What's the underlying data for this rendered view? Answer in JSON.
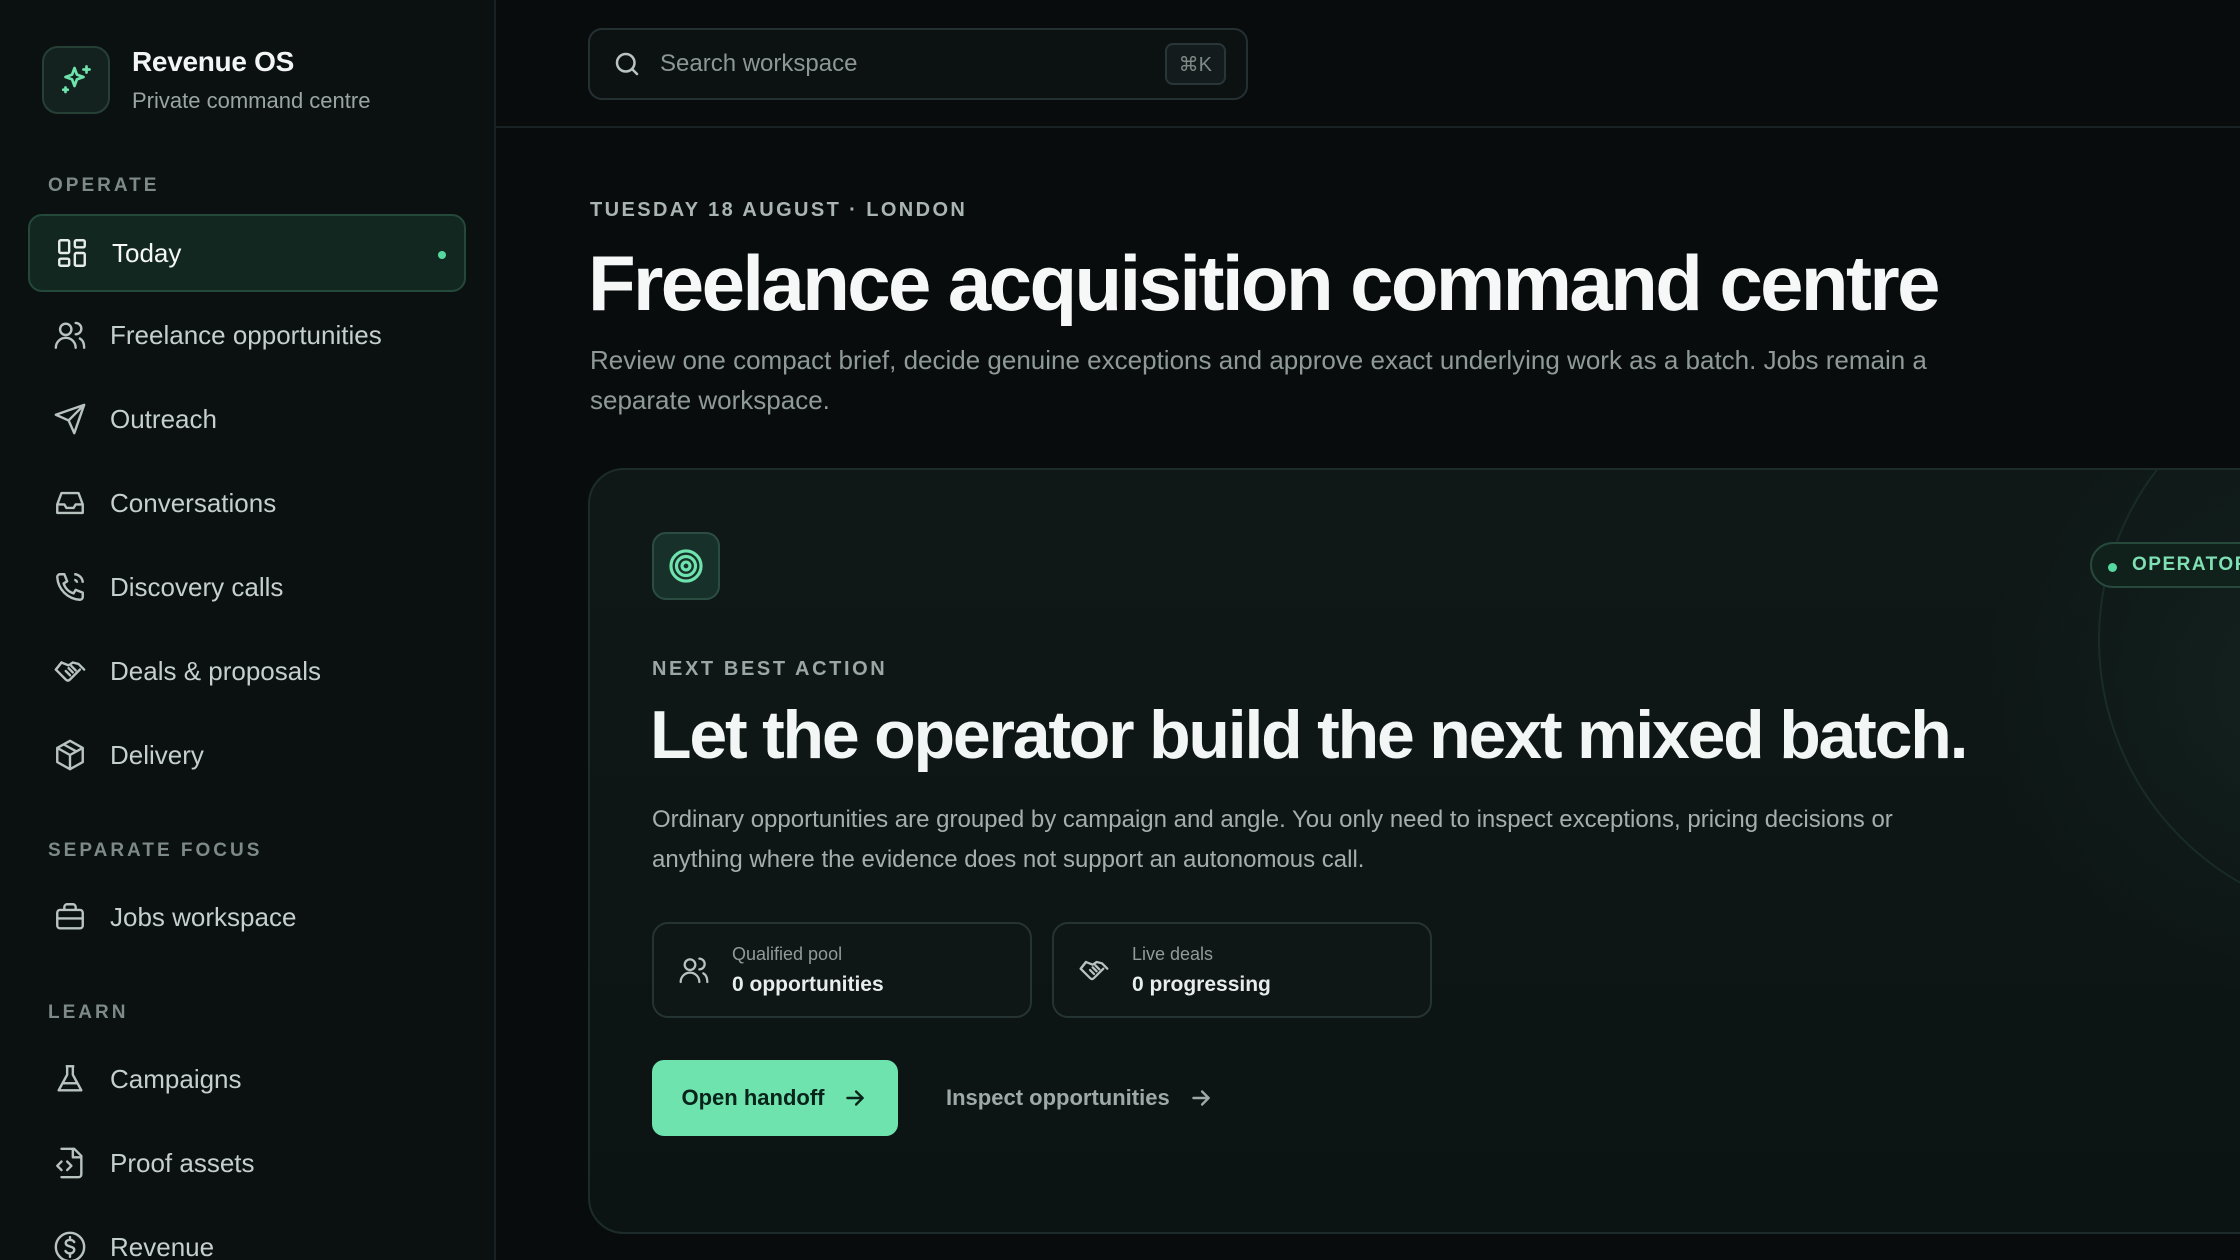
{
  "brand": {
    "name": "Revenue OS",
    "subtitle": "Private command centre"
  },
  "sidebar": {
    "sections": [
      {
        "label": "OPERATE"
      },
      {
        "label": "SEPARATE FOCUS"
      },
      {
        "label": "LEARN"
      }
    ],
    "items": [
      {
        "label": "Today",
        "icon": "dashboard-grid-icon",
        "active": true
      },
      {
        "label": "Freelance opportunities",
        "icon": "users-icon"
      },
      {
        "label": "Outreach",
        "icon": "send-icon"
      },
      {
        "label": "Conversations",
        "icon": "inbox-icon"
      },
      {
        "label": "Discovery calls",
        "icon": "phone-icon"
      },
      {
        "label": "Deals & proposals",
        "icon": "handshake-icon"
      },
      {
        "label": "Delivery",
        "icon": "package-icon"
      },
      {
        "label": "Jobs workspace",
        "icon": "briefcase-icon"
      },
      {
        "label": "Campaigns",
        "icon": "flask-icon"
      },
      {
        "label": "Proof assets",
        "icon": "file-code-icon"
      },
      {
        "label": "Revenue",
        "icon": "dollar-circle-icon"
      }
    ]
  },
  "search": {
    "placeholder": "Search workspace",
    "shortcut": "⌘K"
  },
  "header": {
    "eyebrow": "TUESDAY 18 AUGUST · LONDON",
    "title": "Freelance acquisition command centre",
    "description": "Review one compact brief, decide genuine exceptions and approve exact underlying work as a batch. Jobs remain a separate workspace."
  },
  "card": {
    "icon": "target-icon",
    "status": "OPERATOR R",
    "eyebrow": "NEXT BEST ACTION",
    "title": "Let the operator build the next mixed batch.",
    "description": "Ordinary opportunities are grouped by campaign and angle. You only need to inspect exceptions, pricing decisions or anything where the evidence does not support an autonomous call.",
    "stats": [
      {
        "label": "Qualified pool",
        "value": "0 opportunities",
        "icon": "users-icon"
      },
      {
        "label": "Live deals",
        "value": "0 progressing",
        "icon": "handshake-icon"
      }
    ],
    "primary_action": "Open handoff",
    "secondary_action": "Inspect opportunities"
  },
  "colors": {
    "accent": "#6fe3ad",
    "background": "#080c0d",
    "sidebar": "#0b1011"
  }
}
